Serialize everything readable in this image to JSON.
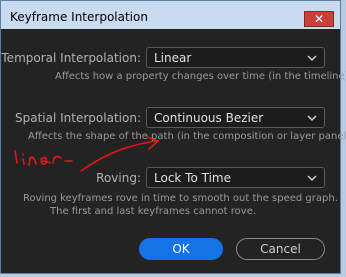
{
  "window": {
    "title": "Keyframe Interpolation",
    "close_glyph": "✕"
  },
  "temporal": {
    "label": "Temporal Interpolation:",
    "value": "Linear",
    "description": "Affects how a property changes over time (in the timeline)."
  },
  "spatial": {
    "label": "Spatial Interpolation:",
    "value": "Continuous Bezier",
    "description": "Affects the shape of the path (in the composition or layer panel)."
  },
  "roving": {
    "label": "Roving:",
    "value": "Lock To Time",
    "description_line1": "Roving keyframes rove in time to smooth out the speed graph.",
    "description_line2": "The first and last keyframes cannot rove."
  },
  "buttons": {
    "ok": "OK",
    "cancel": "Cancel"
  },
  "colors": {
    "accent": "#1473e6",
    "annotation": "#e0181a",
    "close": "#c7403a"
  },
  "annotation": {
    "type": "handwritten-note",
    "icon": "red-arrow"
  }
}
